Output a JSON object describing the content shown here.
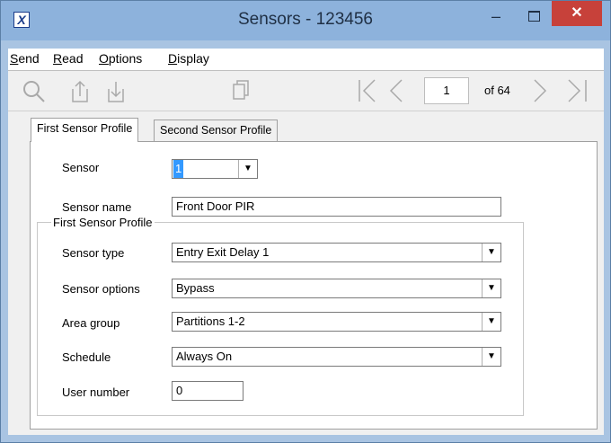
{
  "window": {
    "title": "Sensors - 123456",
    "minimize_glyph": "–",
    "close_glyph": "✕"
  },
  "menu": {
    "send": {
      "mnemonic": "S",
      "rest": "end"
    },
    "read": {
      "mnemonic": "R",
      "rest": "ead"
    },
    "options": {
      "mnemonic": "O",
      "rest": "ptions"
    },
    "display": {
      "mnemonic": "D",
      "rest": "isplay"
    }
  },
  "toolbar": {
    "search_icon": "search-icon",
    "current_page": "1",
    "of_pages": "of 64"
  },
  "tabs": [
    {
      "label": "First Sensor Profile"
    },
    {
      "label": "Second Sensor Profile"
    }
  ],
  "form": {
    "sensor_label": "Sensor",
    "sensor_value": "1",
    "sensor_name_label": "Sensor name",
    "sensor_name_value": "Front Door PIR",
    "group_title": "First Sensor Profile",
    "sensor_type_label": "Sensor type",
    "sensor_type_value": "Entry Exit Delay 1",
    "sensor_options_label": "Sensor options",
    "sensor_options_value": "Bypass",
    "area_group_label": "Area group",
    "area_group_value": "Partitions 1-2",
    "schedule_label": "Schedule",
    "schedule_value": "Always On",
    "user_number_label": "User number",
    "user_number_value": "0"
  },
  "colors": {
    "title_bar": "#8db2dc",
    "close_button": "#c7413a",
    "selection": "#3399ff"
  }
}
